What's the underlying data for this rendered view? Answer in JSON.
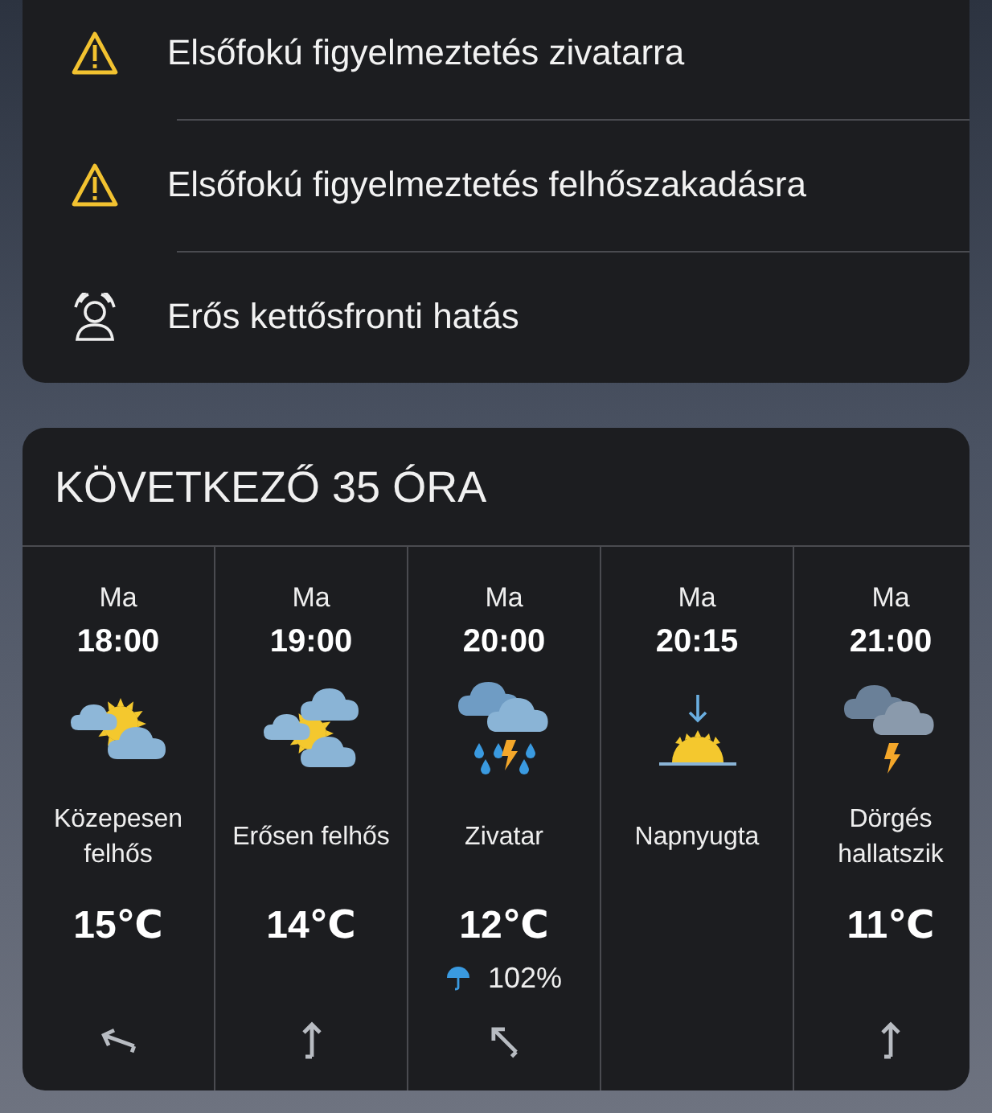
{
  "alerts": [
    {
      "kind": "warning",
      "text": "Elsőfokú figyelmeztetés zivatarra"
    },
    {
      "kind": "warning",
      "text": "Elsőfokú figyelmeztetés felhőszakadásra"
    },
    {
      "kind": "front",
      "text": "Erős kettősfronti hatás"
    }
  ],
  "forecast": {
    "title": "KÖVETKEZŐ 35 ÓRA",
    "hours": [
      {
        "day": "Ma",
        "time": "18:00",
        "kind": "partly_cloudy",
        "condition": "Közepesen felhős",
        "temp": "15℃"
      },
      {
        "day": "Ma",
        "time": "19:00",
        "kind": "mostly_cloudy",
        "condition": "Erősen felhős",
        "temp": "14℃"
      },
      {
        "day": "Ma",
        "time": "20:00",
        "kind": "thunderstorm",
        "condition": "Zivatar",
        "temp": "12℃",
        "precip": "102%"
      },
      {
        "day": "Ma",
        "time": "20:15",
        "kind": "sunset",
        "condition": "Napnyugta"
      },
      {
        "day": "Ma",
        "time": "21:00",
        "kind": "thunder",
        "condition": "Dörgés hallatszik",
        "temp": "11℃"
      }
    ]
  }
}
